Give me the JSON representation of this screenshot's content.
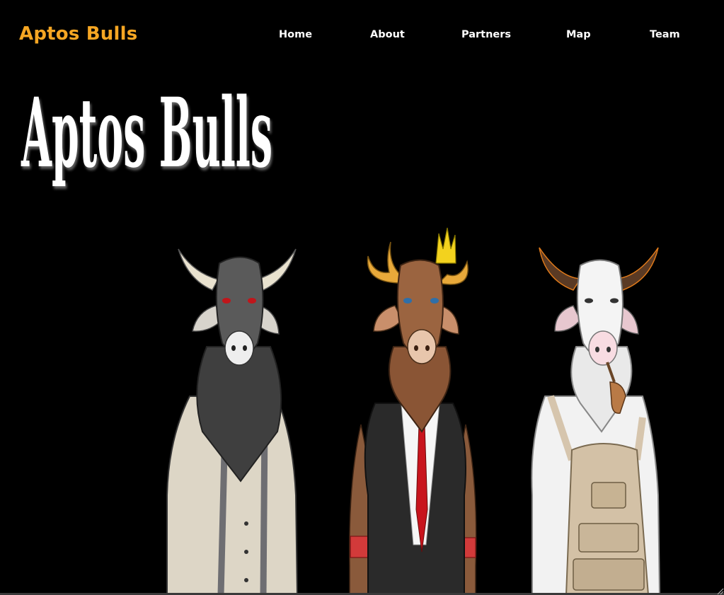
{
  "header": {
    "brand": "Aptos Bulls",
    "nav": [
      {
        "label": "Home"
      },
      {
        "label": "About"
      },
      {
        "label": "Partners"
      },
      {
        "label": "Map"
      },
      {
        "label": "Team"
      }
    ]
  },
  "hero": {
    "logo_text": "Aptos Bulls"
  },
  "colors": {
    "background": "#000000",
    "brand": "#f5a623",
    "nav_text": "#ffffff",
    "logo_text": "#ffffff"
  },
  "characters": [
    {
      "name": "bull-dark-gray-white-shirt"
    },
    {
      "name": "bull-brown-suit-crown"
    },
    {
      "name": "bull-white-pipe-backpack"
    }
  ]
}
